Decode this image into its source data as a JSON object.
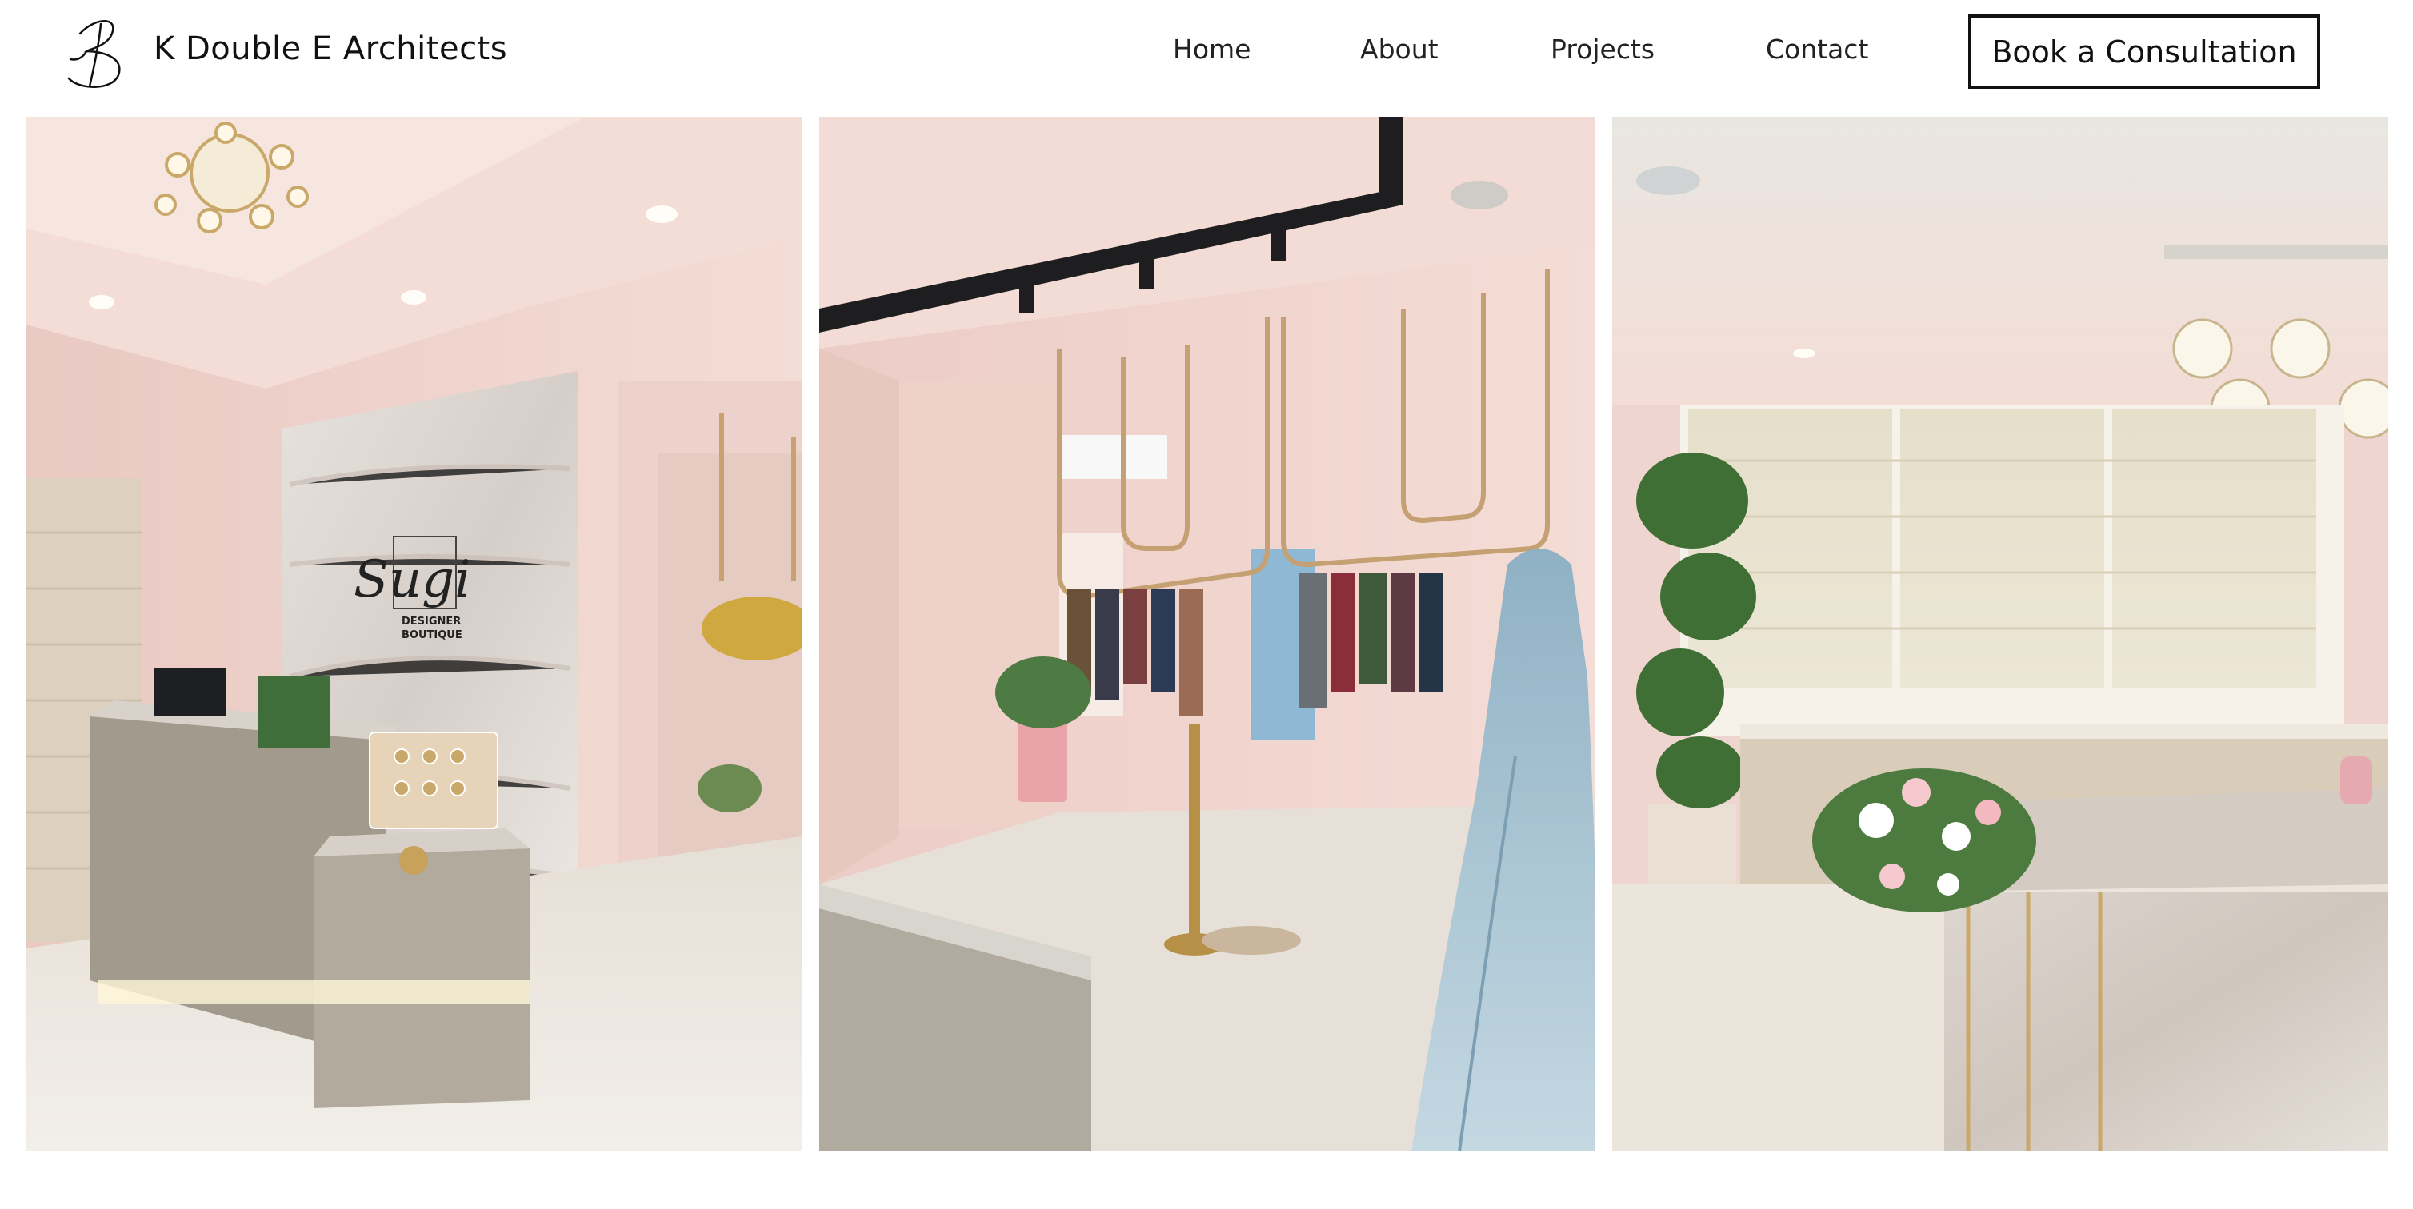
{
  "header": {
    "brand": "K Double E Architects",
    "logo_icon": "kee-signature-logo",
    "nav": [
      {
        "label": "Home"
      },
      {
        "label": "About"
      },
      {
        "label": "Projects"
      },
      {
        "label": "Contact"
      }
    ],
    "cta_label": "Book a Consultation"
  },
  "gallery": {
    "images": [
      {
        "subject": "boutique reception desk with marble feature wall",
        "sign_brand": "Sugi",
        "sign_line1": "DESIGNER",
        "sign_line2": "BOUTIQUE"
      },
      {
        "subject": "boutique display area with hanging rails and mannequin"
      },
      {
        "subject": "boutique interior with roman blinds and marble counter"
      }
    ]
  },
  "colors": {
    "wall_pink": "#efd4cf",
    "ceiling_pink": "#f3ddd6",
    "floor": "#e9e3dc",
    "stone": "#b9afa3",
    "blind": "#e8e1cf",
    "dress_blue": "#a9c3d2"
  }
}
